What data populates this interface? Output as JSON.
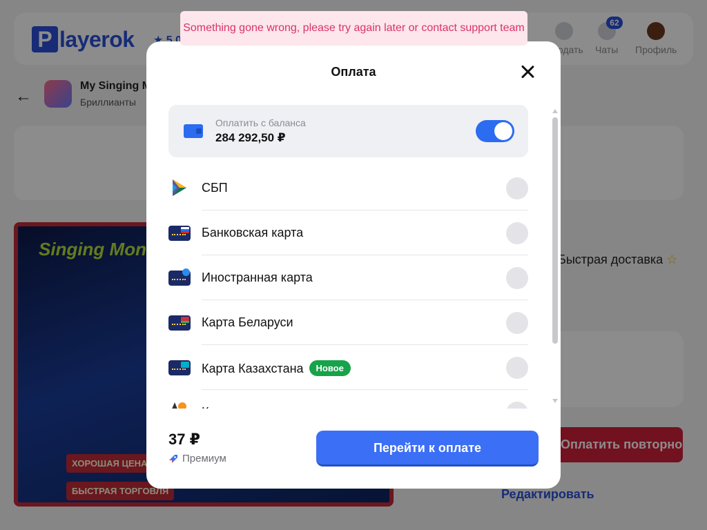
{
  "app": {
    "logo_letter": "P",
    "logo_text": "layerok",
    "rating": "★ 5.0"
  },
  "nav": {
    "sell": "Продать",
    "chats": "Чаты",
    "chats_badge": "62",
    "profile": "Профиль"
  },
  "product": {
    "title": "My Singing M",
    "category": "Бриллианты"
  },
  "banner": {
    "logo": "Singing Monsters",
    "tag1": "ХОРОШАЯ ЦЕНА",
    "tag2": "БЫСТРАЯ ТОРГОВЛЯ"
  },
  "right": {
    "delivery": "Быстрая доставка",
    "retry": "Оплатить повторно",
    "edit": "Редактировать"
  },
  "toast": {
    "message": "Something gone wrong, please try again later or contact support team"
  },
  "modal": {
    "title": "Оплата",
    "balance": {
      "label": "Оплатить с баланса",
      "value": "284 292,50 ₽",
      "enabled": true
    },
    "methods": [
      {
        "label": "СБП",
        "icon": "sbp-icon"
      },
      {
        "label": "Банковская карта",
        "icon": "card-ru-icon",
        "flag": "#d52b1e"
      },
      {
        "label": "Иностранная карта",
        "icon": "card-foreign-icon",
        "flag": "#2b6cf0"
      },
      {
        "label": "Карта Беларуси",
        "icon": "card-by-icon",
        "flag": "#c8313e"
      },
      {
        "label": "Карта Казахстана",
        "icon": "card-kz-icon",
        "flag": "#00afca",
        "badge": "Новое"
      },
      {
        "label": "К",
        "icon": "crypto-icon"
      }
    ],
    "price": "37 ₽",
    "premium": "Премиум",
    "pay_button": "Перейти к оплате"
  },
  "colors": {
    "accent": "#3b6ff5",
    "error_text": "#d8336a",
    "error_bg": "#fde6ec",
    "badge_green": "#17a34a"
  }
}
